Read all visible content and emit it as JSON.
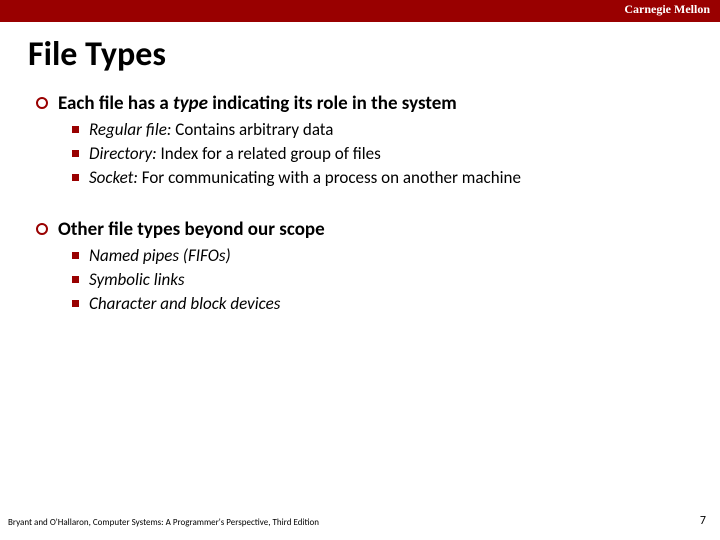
{
  "header": {
    "brand": "Carnegie Mellon"
  },
  "title": "File Types",
  "sections": [
    {
      "text_a": "Each file has a ",
      "text_em": "type",
      "text_b": " indicating its role in the system",
      "items": [
        {
          "em": "Regular file:",
          "rest": " Contains arbitrary data"
        },
        {
          "em": "Directory:",
          "rest": "  Index for a related group of files"
        },
        {
          "em": "Socket:",
          "rest": " For communicating with a process on another machine"
        }
      ]
    },
    {
      "text": "Other file types beyond our scope",
      "items": [
        {
          "em": "Named pipes (FIFOs)"
        },
        {
          "em": "Symbolic links"
        },
        {
          "em": "Character and block devices"
        }
      ]
    }
  ],
  "footer": {
    "citation": "Bryant and O'Hallaron, Computer Systems: A Programmer's Perspective, Third Edition",
    "page": "7"
  },
  "colors": {
    "accent": "#990000"
  }
}
